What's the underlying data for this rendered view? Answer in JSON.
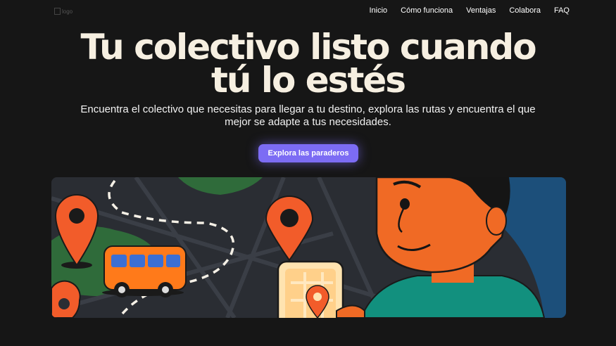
{
  "header": {
    "logo_alt": "logo",
    "nav": [
      {
        "label": "Inicio"
      },
      {
        "label": "Cómo funciona"
      },
      {
        "label": "Ventajas"
      },
      {
        "label": "Colabora"
      },
      {
        "label": "FAQ"
      }
    ]
  },
  "hero": {
    "title_line1": "Tu colectivo listo cuando",
    "title_line2": "tú lo estés",
    "subtitle_line1": "Encuentra el colectivo que necesitas para llegar a tu destino, explora las rutas y encuentra el que",
    "subtitle_line2": "mejor se adapte a tus necesidades.",
    "cta_label": "Explora las paraderos"
  },
  "colors": {
    "background": "#161616",
    "accent": "#7c6cf4",
    "pin": "#f25c2a",
    "bus": "#ff7a1a",
    "map_green": "#2f6b3a",
    "map_blue": "#1c4f7a"
  },
  "illustration": {
    "icons": [
      "map-pin-icon",
      "bus-icon",
      "phone-icon",
      "person-illustration"
    ]
  }
}
